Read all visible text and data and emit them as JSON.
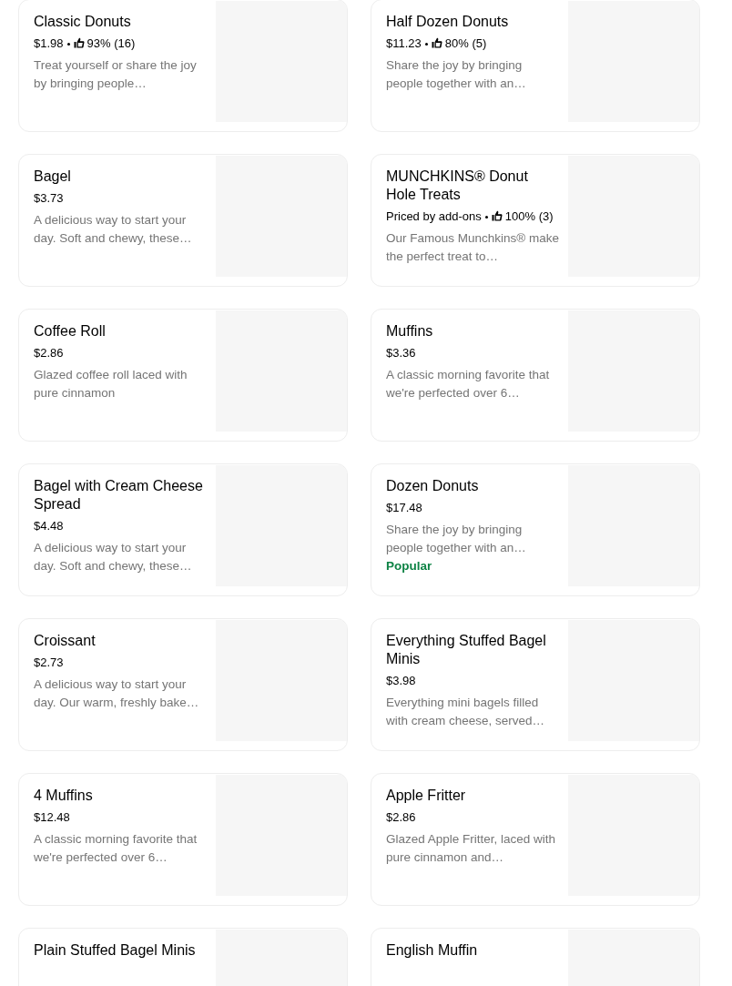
{
  "items": [
    {
      "name": "Classic Donuts",
      "price": "$1.98",
      "rating": "93% (16)",
      "description": "Treat yourself or share the joy by bringing people…"
    },
    {
      "name": "Half Dozen Donuts",
      "price": "$11.23",
      "rating": "80% (5)",
      "description": "Share the joy by bringing people together with an…"
    },
    {
      "name": "Bagel",
      "price": "$3.73",
      "description": "A delicious way to start your day. Soft and chewy, these…"
    },
    {
      "name": "MUNCHKINS® Donut Hole Treats",
      "price": "Priced by add-ons",
      "rating": "100% (3)",
      "description": "Our Famous Munchkins® make the perfect treat to…"
    },
    {
      "name": "Coffee Roll",
      "price": "$2.86",
      "description": "Glazed coffee roll laced with pure cinnamon"
    },
    {
      "name": "Muffins",
      "price": "$3.36",
      "description": "A classic morning favorite that we're perfected over 6…"
    },
    {
      "name": "Bagel with Cream Cheese Spread",
      "price": "$4.48",
      "description": "A delicious way to start your day. Soft and chewy, these…"
    },
    {
      "name": "Dozen Donuts",
      "price": "$17.48",
      "description": "Share the joy by bringing people together with an…",
      "badge": "Popular"
    },
    {
      "name": "Croissant",
      "price": "$2.73",
      "description": "A delicious way to start your day. Our warm, freshly bake…"
    },
    {
      "name": "Everything Stuffed Bagel Minis",
      "price": "$3.98",
      "description": "Everything mini bagels filled with cream cheese, served…"
    },
    {
      "name": "4 Muffins",
      "price": "$12.48",
      "description": "A classic morning favorite that we're perfected over 6…"
    },
    {
      "name": "Apple Fritter",
      "price": "$2.86",
      "description": "Glazed Apple Fritter, laced with pure cinnamon and…"
    },
    {
      "name": "Plain Stuffed Bagel Minis"
    },
    {
      "name": "English Muffin"
    }
  ]
}
